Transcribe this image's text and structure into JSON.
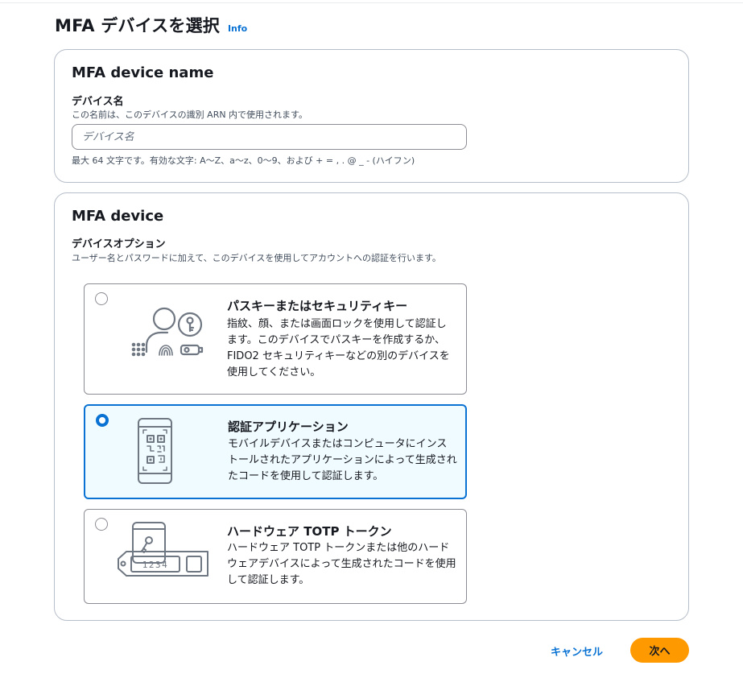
{
  "header": {
    "title": "MFA デバイスを選択",
    "info_label": "Info"
  },
  "device_name_section": {
    "title": "MFA device name",
    "field_label": "デバイス名",
    "field_description": "この名前は、このデバイスの識別 ARN 内で使用されます。",
    "input_value": "",
    "input_placeholder": "デバイス名",
    "constraint_text": "最大 64 文字です。有効な文字: A〜Z、a〜z、0〜9、および + = , . @ _ - (ハイフン)"
  },
  "device_section": {
    "title": "MFA device",
    "field_label": "デバイスオプション",
    "field_description": "ユーザー名とパスワードに加えて、このデバイスを使用してアカウントへの認証を行います。",
    "options": [
      {
        "title": "パスキーまたはセキュリティキー",
        "description": "指紋、顔、または画面ロックを使用して認証します。このデバイスでパスキーを作成するか、FIDO2 セキュリティキーなどの別のデバイスを使用してください。",
        "selected": false,
        "icon": "passkey-icon"
      },
      {
        "title": "認証アプリケーション",
        "description": "モバイルデバイスまたはコンピュータにインストールされたアプリケーションによって生成されたコードを使用して認証します。",
        "selected": true,
        "icon": "authenticator-app-icon"
      },
      {
        "title": "ハードウェア TOTP トークン",
        "description": "ハードウェア TOTP トークンまたは他のハードウェアデバイスによって生成されたコードを使用して認証します。",
        "selected": false,
        "icon": "hardware-token-icon",
        "token_display": "1234"
      }
    ]
  },
  "footer": {
    "cancel_label": "キャンセル",
    "next_label": "次へ"
  },
  "colors": {
    "accent": "#0972d3",
    "primary_button": "#ff9900",
    "selected_tile_bg": "#f0fbff",
    "border": "#b6bec9"
  }
}
